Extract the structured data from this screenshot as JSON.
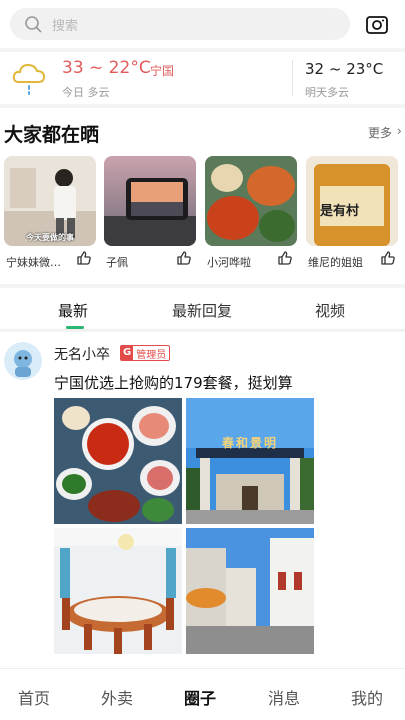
{
  "search": {
    "placeholder": "搜索"
  },
  "weather": {
    "today_range": "33 ~ 22°C",
    "city": "宁国",
    "today_label": "今日 多云",
    "tomorrow_range": "32 ~ 23°C",
    "tomorrow_label": "明天多云"
  },
  "share": {
    "title": "大家都在晒",
    "more_label": "更多",
    "chevron": "›",
    "cards": [
      {
        "name": "宁妹妹微…",
        "caption": "今天要做的事"
      },
      {
        "name": "子佩"
      },
      {
        "name": "小河哗啦"
      },
      {
        "name": "维尼的姐姐",
        "caption": "是有村"
      }
    ]
  },
  "tabs": [
    {
      "label": "最新"
    },
    {
      "label": "最新回复"
    },
    {
      "label": "视频"
    }
  ],
  "post": {
    "username": "无名小卒",
    "badge_icon": "G",
    "badge_label": "管理员",
    "text": "宁国优选上抢购的179套餐，挺划算",
    "sign_text": "春和景明"
  },
  "bottom_nav": [
    {
      "label": "首页"
    },
    {
      "label": "外卖"
    },
    {
      "label": "圈子"
    },
    {
      "label": "消息"
    },
    {
      "label": "我的"
    }
  ],
  "colors": {
    "accent": "#2bb673",
    "hot": "#e25b5b",
    "badge": "#e34a4a"
  }
}
